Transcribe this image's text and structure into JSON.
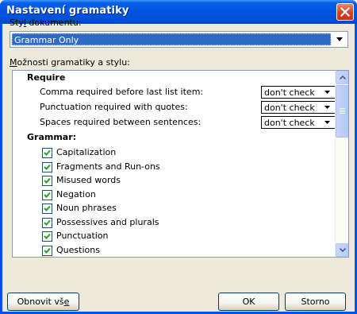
{
  "window": {
    "title": "Nastavení gramatiky"
  },
  "style_label": {
    "before": "Sty",
    "accel": "l",
    "after": " dokumentu:"
  },
  "style_combo": {
    "value": "Grammar Only"
  },
  "options_label": {
    "accel": "M",
    "after": "ožnosti gramatiky a stylu:"
  },
  "list": {
    "require_header": "Require",
    "require_items": [
      {
        "label": "Comma required before last list item:",
        "value": "don't check"
      },
      {
        "label": "Punctuation required with quotes:",
        "value": "don't check"
      },
      {
        "label": "Spaces required between sentences:",
        "value": "don't check"
      }
    ],
    "grammar_header": "Grammar:",
    "grammar_items": [
      {
        "label": "Capitalization",
        "checked": true
      },
      {
        "label": "Fragments and Run-ons",
        "checked": true
      },
      {
        "label": "Misused words",
        "checked": true
      },
      {
        "label": "Negation",
        "checked": true
      },
      {
        "label": "Noun phrases",
        "checked": true
      },
      {
        "label": "Possessives and plurals",
        "checked": true
      },
      {
        "label": "Punctuation",
        "checked": true
      },
      {
        "label": "Questions",
        "checked": true
      }
    ]
  },
  "buttons": {
    "reset": {
      "before": "Obnovit vš",
      "accel": "e"
    },
    "ok": "OK",
    "cancel": "Storno"
  }
}
